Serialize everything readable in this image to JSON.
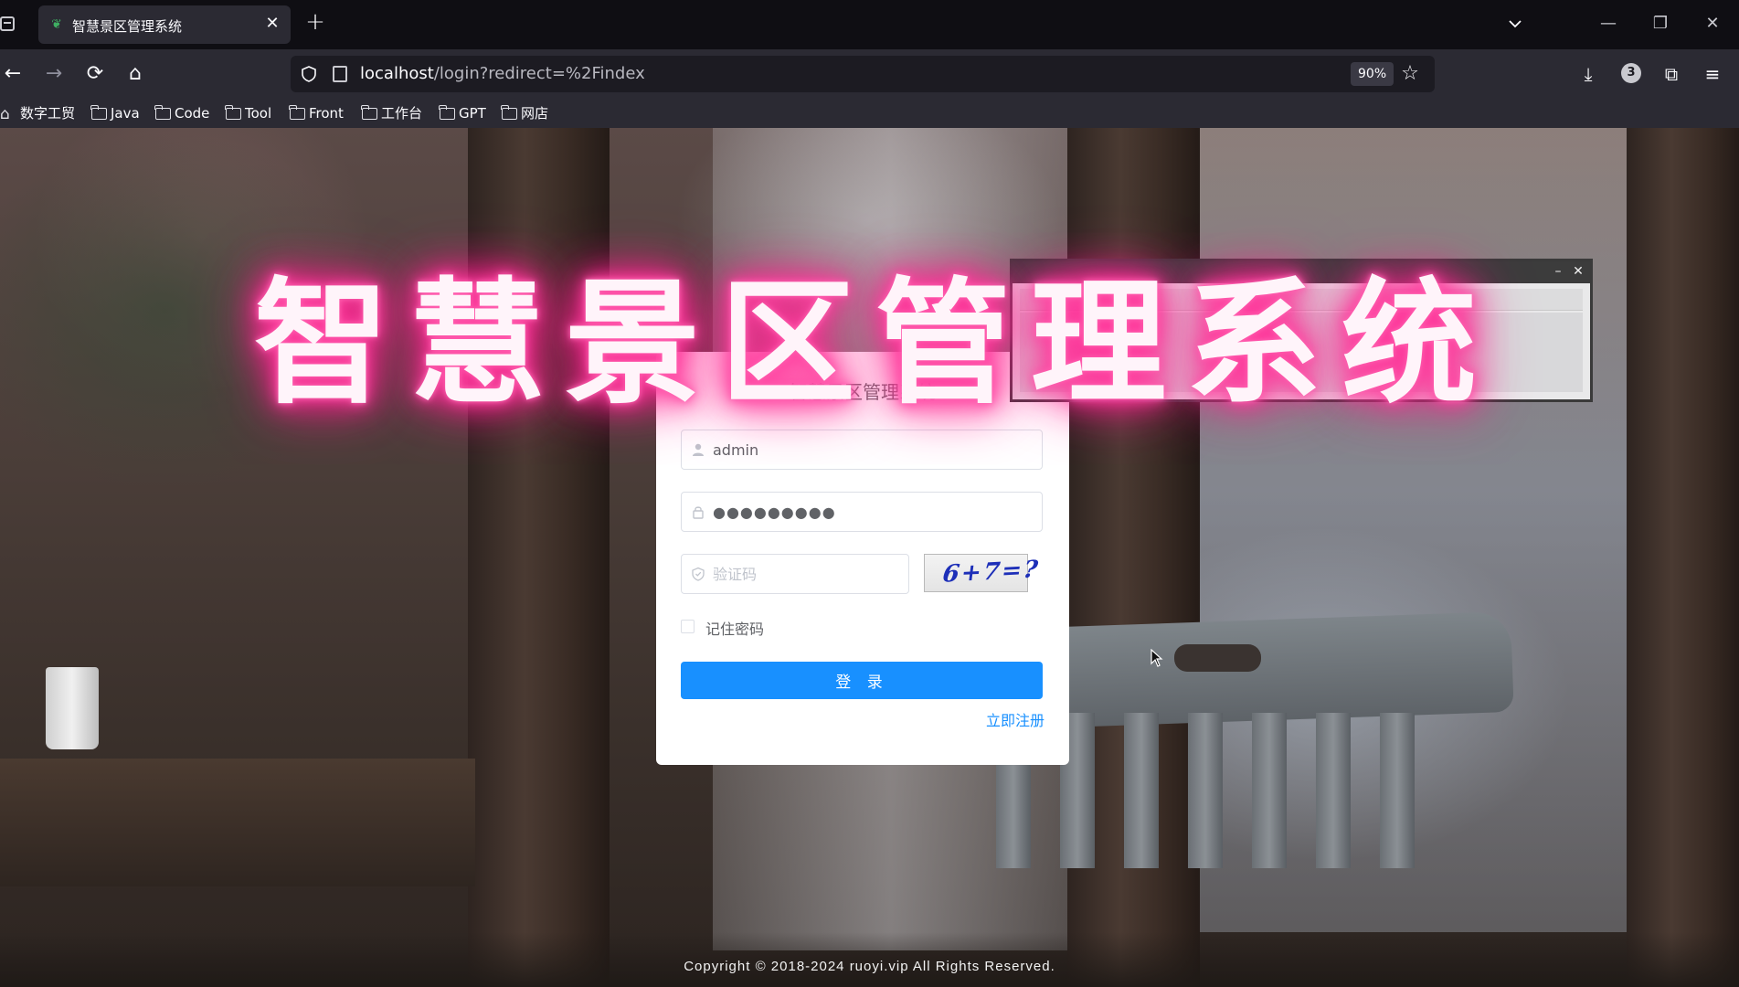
{
  "browser": {
    "tab_title": "智慧景区管理系统",
    "url_host": "localhost",
    "url_path": "/login?redirect=%2Findex",
    "zoom": "90%",
    "extensions_badge": "3"
  },
  "bookmarks": [
    {
      "label": "数字工贸",
      "icon": "home-icon"
    },
    {
      "label": "Java",
      "icon": "folder-icon"
    },
    {
      "label": "Code",
      "icon": "folder-icon"
    },
    {
      "label": "Tool",
      "icon": "folder-icon"
    },
    {
      "label": "Front",
      "icon": "folder-icon"
    },
    {
      "label": "工作台",
      "icon": "folder-icon"
    },
    {
      "label": "GPT",
      "icon": "folder-icon"
    },
    {
      "label": "网店",
      "icon": "folder-icon"
    }
  ],
  "overlay": {
    "neon_title": "智慧景区管理系统"
  },
  "login": {
    "title": "智慧景区管理系统",
    "username_value": "admin",
    "password_value": "●●●●●●●●●",
    "code_placeholder": "验证码",
    "captcha_text": "6+7=?",
    "remember_label": "记住密码",
    "remember_checked": false,
    "submit_label": "登 录",
    "register_link": "立即注册"
  },
  "footer": {
    "copyright": "Copyright © 2018-2024 ruoyi.vip All Rights Reserved."
  },
  "colors": {
    "primary": "#1890ff",
    "neon": "#ff3399"
  }
}
